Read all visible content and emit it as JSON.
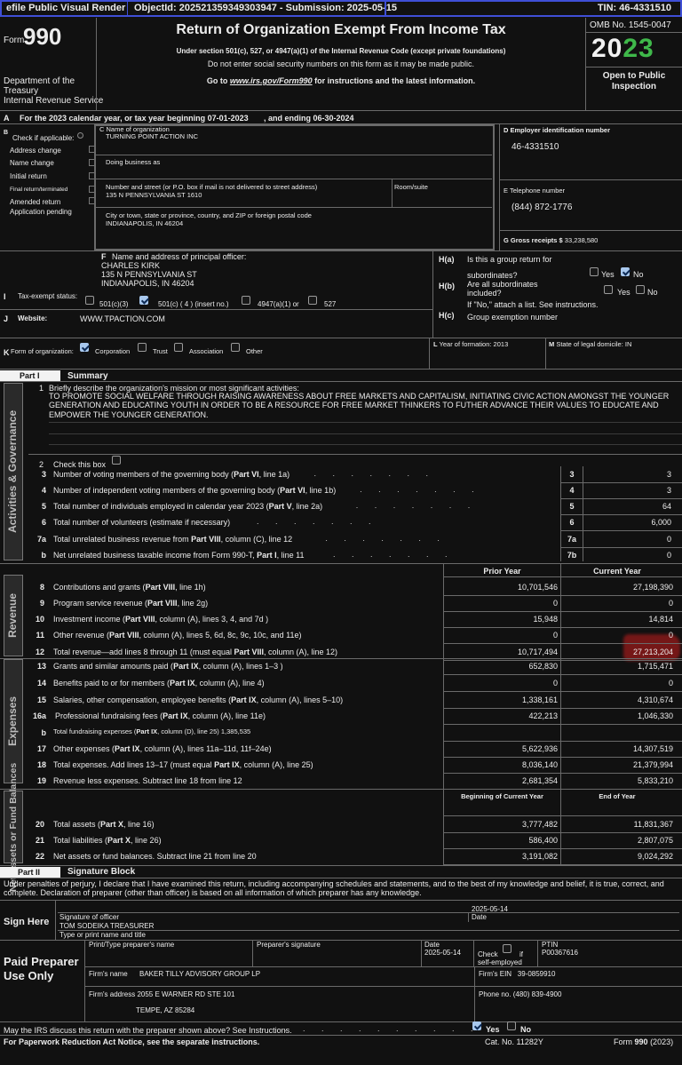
{
  "banner": {
    "left": "efile Public Visual Render",
    "object_id": "ObjectId: 202521359349303947 - Submission: 2025-05-15",
    "tin": "TIN: 46-4331510"
  },
  "header": {
    "form_word": "Form",
    "form_num": "990",
    "dept": [
      "Department of the",
      "Treasury",
      "Internal Revenue Service"
    ],
    "title": "Return of Organization Exempt From Income Tax",
    "sub1": "Under section 501(c), 527, or 4947(a)(1) of the Internal Revenue Code (except private foundations)",
    "sub2": "Do not enter social security numbers on this form as it may be made public.",
    "sub3_pre": "Go to ",
    "sub3_link": "www.irs.gov/Form990",
    "sub3_post": " for instructions and the latest information.",
    "omb": "OMB No. 1545-0047",
    "year_a": "20",
    "year_b": "23",
    "open1": "Open to Public",
    "open2": "Inspection"
  },
  "line_a": {
    "letter": "A",
    "text": "For the 2023 calendar year, or tax year beginning 07-01-2023",
    "end": ", and ending 06-30-2024"
  },
  "block_b": {
    "letter": "B",
    "title": "Check if applicable:",
    "items": [
      "Address change",
      "Name change",
      "Initial return",
      "Final return/terminated",
      "Amended return",
      "Application pending"
    ]
  },
  "block_c": {
    "label": "C Name of organization",
    "name": "TURNING POINT ACTION INC",
    "dba_label": "Doing business as",
    "street_label": "Number and street (or P.O. box if mail is not delivered to street address)",
    "street": "135 N PENNSYLVANIA ST 1610",
    "room_label": "Room/suite",
    "city_label": "City or town, state or province, country, and ZIP or foreign postal code",
    "city": "INDIANAPOLIS, IN   46204"
  },
  "block_d": {
    "label": "D Employer identification number",
    "ein": "46-4331510",
    "phone_label": "E Telephone number",
    "phone": "(844) 872-1776",
    "gross_label": "G Gross receipts $",
    "gross": "33,238,580"
  },
  "block_f": {
    "letter": "F",
    "label": "Name and address of principal officer:",
    "l1": "CHARLES KIRK",
    "l2": "135 N PENNSYLVANIA ST",
    "l3": "INDIANAPOLIS, IN   46204"
  },
  "block_h": {
    "ha": "H(a)",
    "ha_t1": "Is this a group return for",
    "ha_t2": "subordinates?",
    "hb": "H(b)",
    "hb_t1": "Are all subordinates",
    "hb_t2": "included?",
    "hb_note": "If \"No,\" attach a list. See instructions.",
    "hc": "H(c)",
    "hc_t": "Group exemption number",
    "yes": "Yes",
    "no": "No"
  },
  "line_i": {
    "letter": "I",
    "label": "Tax-exempt status:",
    "o1": "501(c)(3)",
    "o2": "501(c) ( 4 ) (insert no.)",
    "o3": "4947(a)(1) or",
    "o4": "527"
  },
  "line_j": {
    "letter": "J",
    "label": "Website:",
    "value": "WWW.TPACTION.COM"
  },
  "line_k": {
    "letter": "K",
    "label": "Form of organization:",
    "o1": "Corporation",
    "o2": "Trust",
    "o3": "Association",
    "o4": "Other"
  },
  "line_l": {
    "letter": "L",
    "text": "Year of formation: 2013"
  },
  "line_m": {
    "letter": "M",
    "text": "State of legal domicile: IN"
  },
  "part1": {
    "tag": "Part I",
    "title": "Summary"
  },
  "sidebars": {
    "gov": "Activities & Governance",
    "rev": "Revenue",
    "exp": "Expenses",
    "net": "Net Assets or Fund Balances"
  },
  "mission": {
    "num": "1",
    "q": "Briefly describe the organization's mission or most significant activities:",
    "text": "TO PROMOTE SOCIAL WELFARE THROUGH RAISING AWARENESS ABOUT FREE MARKETS AND CAPITALISM, INITIATING CIVIC ACTION AMONGST THE YOUNGER GENERATION AND EDUCATING YOUTH IN ORDER TO BE A RESOURCE FOR FREE MARKET THINKERS TO FUTHER ADVANCE THEIR VALUES TO EDUCATE AND EMPOWER THE YOUNGER GENERATION."
  },
  "line2": {
    "num": "2",
    "text": "Check this box"
  },
  "gov_lines": [
    {
      "num": "3",
      "text": "Number of voting members of the governing body (Part VI, line 1a)",
      "box": "3",
      "val": "3"
    },
    {
      "num": "4",
      "text": "Number of independent voting members of the governing body (Part VI, line 1b)",
      "box": "4",
      "val": "3"
    },
    {
      "num": "5",
      "text": "Total number of individuals employed in calendar year 2023 (Part V, line 2a)",
      "box": "5",
      "val": "64"
    },
    {
      "num": "6",
      "text": "Total number of volunteers (estimate if necessary)",
      "box": "6",
      "val": "6,000"
    },
    {
      "num": "7a",
      "text": "Total unrelated business revenue from Part VIII, column (C), line 12",
      "box": "7a",
      "val": "0"
    },
    {
      "num": "b",
      "text": "Net unrelated business taxable income from Form 990-T, Part I, line 11",
      "box": "7b",
      "val": "0"
    }
  ],
  "col_heads": {
    "prior": "Prior Year",
    "current": "Current Year",
    "boy": "Beginning of Current Year",
    "eoy": "End of Year"
  },
  "rev_lines": [
    {
      "num": "8",
      "text": "Contributions and grants (Part VIII, line 1h)",
      "prior": "10,701,546",
      "cur": "27,198,390"
    },
    {
      "num": "9",
      "text": "Program service revenue (Part VIII, line 2g)",
      "prior": "0",
      "cur": "0"
    },
    {
      "num": "10",
      "text": "Investment income (Part VIII, column (A), lines 3, 4, and 7d )",
      "prior": "15,948",
      "cur": "14,814"
    },
    {
      "num": "11",
      "text": "Other revenue (Part VIII, column (A), lines 5, 6d, 8c, 9c, 10c, and 11e)",
      "prior": "0",
      "cur": "0"
    },
    {
      "num": "12",
      "text": "Total revenue—add lines 8 through 11 (must equal Part VIII, column (A), line 12)",
      "prior": "10,717,494",
      "cur": "27,213,204"
    }
  ],
  "exp_lines": [
    {
      "num": "13",
      "text": "Grants and similar amounts paid (Part IX, column (A), lines 1–3 )",
      "prior": "652,830",
      "cur": "1,715,471"
    },
    {
      "num": "14",
      "text": "Benefits paid to or for members (Part IX, column (A), line 4)",
      "prior": "0",
      "cur": "0"
    },
    {
      "num": "15",
      "text": "Salaries, other compensation, employee benefits (Part IX, column (A), lines 5–10)",
      "prior": "1,338,161",
      "cur": "4,310,674"
    },
    {
      "num": "16a",
      "text": "Professional fundraising fees (Part IX, column (A), line 11e)",
      "prior": "422,213",
      "cur": "1,046,330"
    },
    {
      "num": "b",
      "text": "Total fundraising expenses (Part IX, column (D), line 25) 1,385,535",
      "prior": "",
      "cur": ""
    },
    {
      "num": "17",
      "text": "Other expenses (Part IX, column (A), lines 11a–11d, 11f–24e)",
      "prior": "5,622,936",
      "cur": "14,307,519"
    },
    {
      "num": "18",
      "text": "Total expenses. Add lines 13–17 (must equal Part IX, column (A), line 25)",
      "prior": "8,036,140",
      "cur": "21,379,994"
    },
    {
      "num": "19",
      "text": "Revenue less expenses. Subtract line 18 from line 12",
      "prior": "2,681,354",
      "cur": "5,833,210"
    }
  ],
  "net_lines": [
    {
      "num": "20",
      "text": "Total assets (Part X, line 16)",
      "boy": "3,777,482",
      "eoy": "11,831,367"
    },
    {
      "num": "21",
      "text": "Total liabilities (Part X, line 26)",
      "boy": "586,400",
      "eoy": "2,807,075"
    },
    {
      "num": "22",
      "text": "Net assets or fund balances. Subtract line 21 from line 20",
      "boy": "3,191,082",
      "eoy": "9,024,292"
    }
  ],
  "part2": {
    "tag": "Part II",
    "title": "Signature Block",
    "perjury": "Under penalties of perjury, I declare that I have examined this return, including accompanying schedules and statements, and to the best of my knowledge and belief, it is true, correct, and complete. Declaration of preparer (other than officer) is based on all information of which preparer has any knowledge."
  },
  "sign": {
    "here": "Sign Here",
    "date_val": "2025-05-14",
    "sig_label": "Signature of officer",
    "date_label": "Date",
    "officer": "TOM SODEIKA  TREASURER",
    "name_label": "Type or print name and title"
  },
  "preparer": {
    "title1": "Paid Preparer",
    "title2": "Use Only",
    "name_label": "Print/Type preparer's name",
    "sig_label": "Preparer's signature",
    "date_label": "Date",
    "date_val": "2025-05-14",
    "check_label": "Check",
    "if": "if",
    "self": "self-employed",
    "ptin_label": "PTIN",
    "ptin": "P00367616",
    "firm_label": "Firm's name",
    "firm": "BAKER TILLY ADVISORY GROUP LP",
    "ein_label": "Firm's EIN",
    "ein": "39-0859910",
    "addr_label": "Firm's address",
    "addr1": "2055 E WARNER RD STE 101",
    "addr2": "TEMPE, AZ   85284",
    "phone_label": "Phone no.",
    "phone": "(480) 839-4900"
  },
  "footer": {
    "discuss": "May the IRS discuss this return with the preparer shown above? See Instructions.",
    "yes": "Yes",
    "no": "No",
    "paperwork": "For Paperwork Reduction Act Notice, see the separate instructions.",
    "cat": "Cat. No. 11282Y",
    "form_a": "Form",
    "form_b": "990",
    "form_c": "(2023)"
  }
}
